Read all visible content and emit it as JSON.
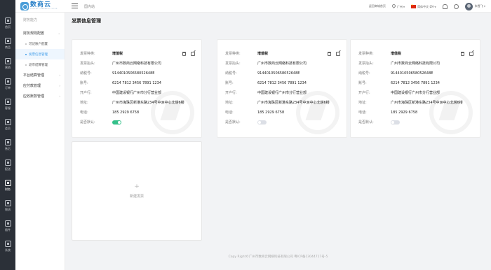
{
  "rail": [
    {
      "icon": "home-icon",
      "label": "首页"
    },
    {
      "icon": "goods-icon",
      "label": "商品"
    },
    {
      "icon": "content-icon",
      "label": "营销"
    },
    {
      "icon": "order-icon",
      "label": "订单"
    },
    {
      "icon": "user-icon",
      "label": "客服"
    },
    {
      "icon": "finance-icon",
      "label": "会员"
    },
    {
      "icon": "report-icon",
      "label": "售后"
    },
    {
      "icon": "pay-icon",
      "label": "配送"
    },
    {
      "icon": "finance-icon",
      "label": "财务"
    },
    {
      "icon": "data-icon",
      "label": "物流"
    },
    {
      "icon": "tool-icon",
      "label": "插件"
    },
    {
      "icon": "system-icon",
      "label": "系统"
    }
  ],
  "brand": {
    "name": "数商云",
    "sub": "DIGITAL COMMERCE CLOUD"
  },
  "header": {
    "breadcrumb": "国内站",
    "back_link": "返回商城首页",
    "location": "广州",
    "language": "简体中文-ZH",
    "username": "朱雪飞"
  },
  "sidebar": {
    "title": "财务能力",
    "groups": [
      {
        "label": "财务规则配置",
        "items": [
          {
            "label": "可记账户配置",
            "active": false
          },
          {
            "label": "发票信息管理",
            "active": true
          },
          {
            "label": "退币结算管理",
            "active": false
          }
        ]
      },
      {
        "label": "平台结算管理",
        "items": []
      },
      {
        "label": "应付款管理",
        "items": []
      },
      {
        "label": "应收账款管理",
        "items": []
      }
    ]
  },
  "page": {
    "title": "发票信息管理"
  },
  "labels": {
    "type": "发票种类:",
    "title": "发票抬头:",
    "tax": "纳税号:",
    "account": "账号:",
    "bank": "开户行:",
    "address": "地址:",
    "phone": "电话:",
    "default": "是否默认:"
  },
  "invoices": [
    {
      "type": "增值税",
      "title": "广州市数商云网络科技有限公司",
      "tax": "914401050658052648E",
      "account": "6214 7812 3456 7891 1234",
      "bank": "中国建设银行广州市分行营业部",
      "address": "广州市海珠区新港东路234号中洲中心北塔6楼",
      "phone": "185 2929 6758",
      "is_default": true
    },
    {
      "type": "增值税",
      "title": "广州市数商云网络科技有限公司",
      "tax": "914401050658052648E",
      "account": "6214 7812 3456 7891 1234",
      "bank": "中国建设银行广州市分行营业部",
      "address": "广州市海珠区新港东路234号中洲中心北塔6楼",
      "phone": "185 2929 6758",
      "is_default": false
    },
    {
      "type": "增值税",
      "title": "广州市数商云网络科技有限公司",
      "tax": "914401050658052648E",
      "account": "6214 7812 3456 7891 1234",
      "bank": "中国建设银行广州市分行营业部",
      "address": "广州市海珠区新港东路234号中洲中心北塔6楼",
      "phone": "185 2929 6758",
      "is_default": false
    }
  ],
  "add_card": {
    "label": "新建发票"
  },
  "footer": "Copy Right©广州市数商云网络科技有限公司 粤ICP备13044717号-5",
  "colors": {
    "rail_bg": "#2b3038",
    "accent": "#3d9be9",
    "toggle_on": "#34c08a"
  }
}
